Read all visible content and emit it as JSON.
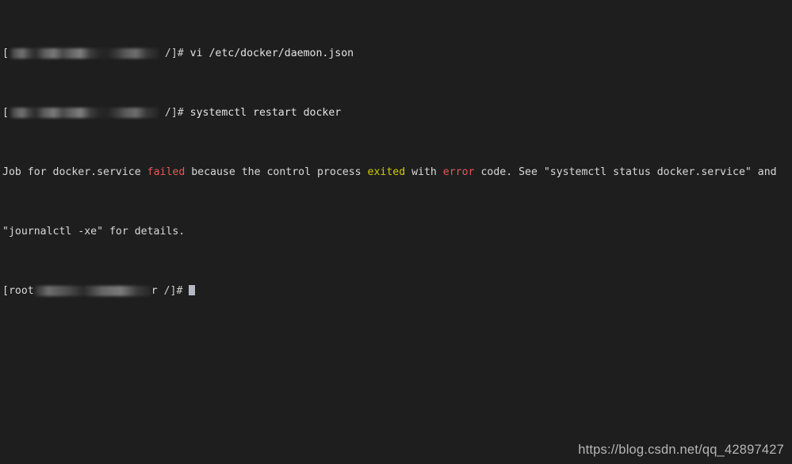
{
  "terminal": {
    "background_color": "#1e1e1e",
    "foreground_color": "#d9d9d9",
    "colors": {
      "red": "#e05a5a",
      "yellow": "#cdcd00",
      "white": "#e4e4e4",
      "cursor": "#b8b8c4"
    },
    "lines": [
      {
        "id": "line-1",
        "type": "prompt-command",
        "prompt_prefix": "[",
        "redacted_label": "redacted-user-host",
        "prompt_suffix": " /]# ",
        "command": "vi /etc/docker/daemon.json"
      },
      {
        "id": "line-2",
        "type": "prompt-command",
        "prompt_prefix": "[",
        "redacted_label": "redacted-user-host",
        "prompt_suffix": " /]# ",
        "command": "systemctl restart docker"
      },
      {
        "id": "line-3",
        "type": "output",
        "segments": [
          {
            "text": "Job for docker.service ",
            "color": "default"
          },
          {
            "text": "failed",
            "color": "red"
          },
          {
            "text": " because the control process ",
            "color": "default"
          },
          {
            "text": "exited",
            "color": "yellow"
          },
          {
            "text": " with ",
            "color": "default"
          },
          {
            "text": "error",
            "color": "red"
          },
          {
            "text": " code. See \"systemctl status docker.service\" and",
            "color": "default"
          }
        ]
      },
      {
        "id": "line-4",
        "type": "output",
        "text": "\"journalctl -xe\" for details."
      },
      {
        "id": "line-5",
        "type": "prompt-cursor",
        "prompt_prefix": "[root",
        "redacted_label": "redacted-host-path",
        "prompt_mid": "r",
        "prompt_suffix": " /]# ",
        "cursor": "block-cursor"
      }
    ]
  },
  "watermark": {
    "text": "https://blog.csdn.net/qq_42897427"
  }
}
